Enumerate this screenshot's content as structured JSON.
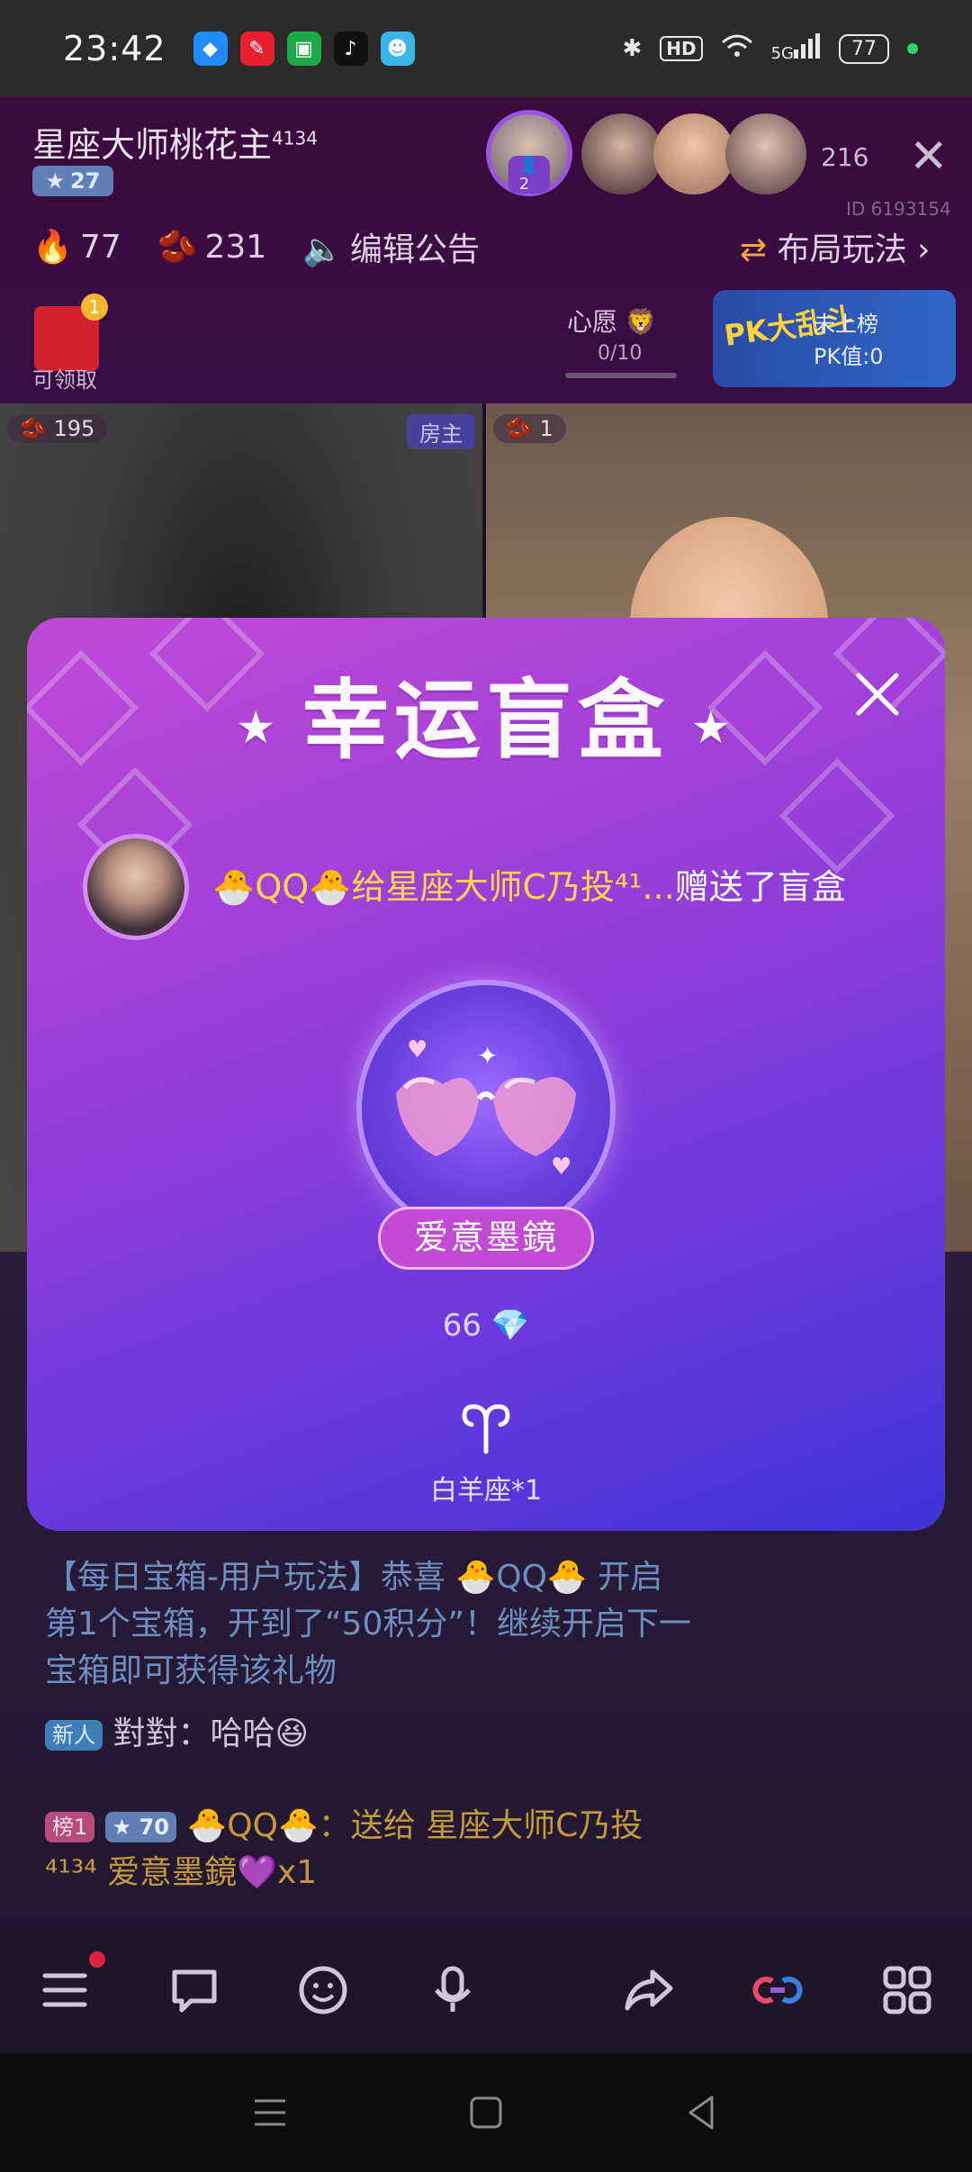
{
  "status_bar": {
    "time": "23:42",
    "hd": "HD",
    "network": "5G",
    "battery": "77"
  },
  "room": {
    "title": "星座大师桃花主",
    "title_sup": "4134",
    "level": "27",
    "host_viewer_count": "2",
    "audience_count": "216",
    "room_id": "ID 6193154",
    "heat": "77",
    "beans": "231",
    "edit_notice_label": "编辑公告",
    "layout_label": "布局玩法",
    "red_packet_badge": "1",
    "red_packet_label": "可领取",
    "wish_label": "心愿",
    "wish_progress": "0/10",
    "pk_logo": "PK大乱斗",
    "pk_status": "未上榜",
    "pk_value": "PK值:0"
  },
  "video": {
    "left_beans": "195",
    "host_tag": "房主",
    "right_beans": "1"
  },
  "modal": {
    "title": "幸运盲盒",
    "sender_prefix": "🐣QQ🐣给",
    "recipient": "星座大师C乃投⁴¹...",
    "action": "赠送了盲盒",
    "gift_name": "爱意墨鏡",
    "gift_price": "66",
    "zodiac_label": "白羊座*1"
  },
  "chat": {
    "system_message": "【每日宝箱-用户玩法】恭喜 🐣QQ🐣 开启第1个宝箱，开到了“50积分”！继续开启下一宝箱即可获得该礼物",
    "new_tag": "新人",
    "user_message": "對對：哈哈😆",
    "rank_tag": "榜1",
    "level_tag": "70",
    "gift_message": "🐣QQ🐣：送给 星座大师C乃投⁴¹³⁴ 爱意墨鏡💜x1"
  },
  "colors": {
    "modal_gradient_start": "#c04ad8",
    "modal_gradient_end": "#3e33d8",
    "highlight_yellow": "#ffd84d",
    "gift_pill": "#c24bd3"
  }
}
